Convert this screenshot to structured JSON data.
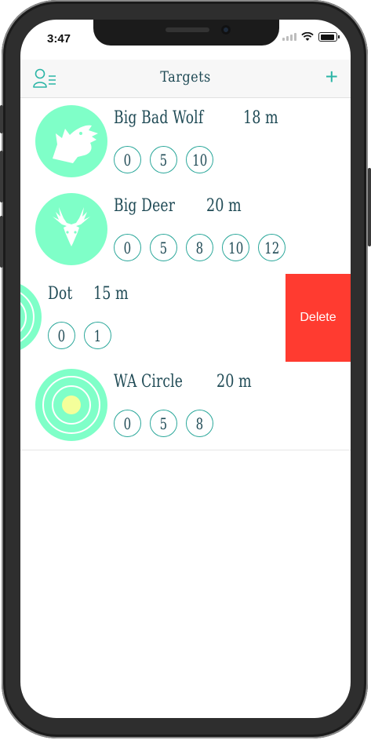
{
  "status_bar": {
    "time": "3:47"
  },
  "nav": {
    "title": "Targets",
    "add_symbol": "+",
    "profile_icon": "profile-list-icon"
  },
  "colors": {
    "accent": "#2bb5a6",
    "avatar_bg": "#7fffc8",
    "title_text": "#1f4a55",
    "delete": "#ff3b30"
  },
  "targets": [
    {
      "name": "Big Bad Wolf",
      "distance": "18 m",
      "icon": "wolf-head-icon",
      "zones": [
        "0",
        "5",
        "10"
      ]
    },
    {
      "name": "Big Deer",
      "distance": "20 m",
      "icon": "deer-head-icon",
      "zones": [
        "0",
        "5",
        "8",
        "10",
        "12"
      ]
    },
    {
      "name": "Dot",
      "distance": "15 m",
      "icon": "dot-target-icon",
      "zones": [
        "0",
        "1"
      ],
      "swiped": true,
      "delete_label": "Delete"
    },
    {
      "name": "WA Circle",
      "distance": "20 m",
      "icon": "wa-circle-icon",
      "zones": [
        "0",
        "5",
        "8"
      ]
    }
  ]
}
